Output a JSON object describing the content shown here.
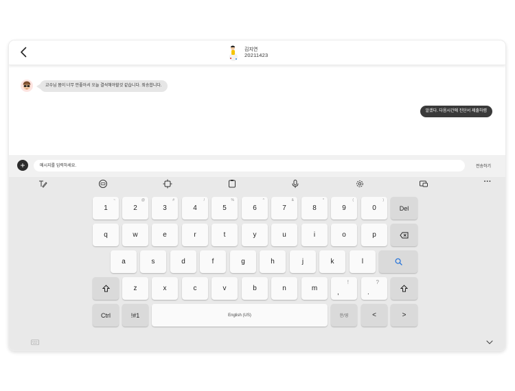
{
  "chat": {
    "back_icon": "chevron-left-icon",
    "contact_name": "김지연",
    "contact_id": "20211423",
    "messages": [
      {
        "direction": "incoming",
        "text": "교수님 몸이 너무 안좋아서 오늘 결석해야할것 같습니다. 죄송합니다."
      },
      {
        "direction": "outgoing",
        "text": "알겠다. 다음시간에 진단서 제출하렴"
      }
    ]
  },
  "composer": {
    "add_icon": "plus-icon",
    "add_label": "+",
    "placeholder": "메시지를 입력하세요.",
    "send_label": "전송하기"
  },
  "keyboard": {
    "toolbar": [
      {
        "name": "handwriting-icon"
      },
      {
        "name": "emoji-icon"
      },
      {
        "name": "resize-icon"
      },
      {
        "name": "clipboard-icon"
      },
      {
        "name": "microphone-icon"
      },
      {
        "name": "settings-icon"
      },
      {
        "name": "one-handed-keyboard-icon"
      },
      {
        "name": "more-icon",
        "label": "···"
      }
    ],
    "number_row": [
      {
        "label": "1",
        "sub": "~"
      },
      {
        "label": "2",
        "sub": "@"
      },
      {
        "label": "3",
        "sub": "#"
      },
      {
        "label": "4",
        "sub": "/"
      },
      {
        "label": "5",
        "sub": "%"
      },
      {
        "label": "6",
        "sub": "^"
      },
      {
        "label": "7",
        "sub": "&"
      },
      {
        "label": "8",
        "sub": "*"
      },
      {
        "label": "9",
        "sub": "("
      },
      {
        "label": "0",
        "sub": ")"
      }
    ],
    "del_label": "Del",
    "row_q": [
      "q",
      "w",
      "e",
      "r",
      "t",
      "y",
      "u",
      "i",
      "o",
      "p"
    ],
    "backspace_icon": "backspace-icon",
    "row_a": [
      "a",
      "s",
      "d",
      "f",
      "g",
      "h",
      "j",
      "k",
      "l"
    ],
    "search_icon": "search-icon",
    "shift_icon": "shift-icon",
    "row_z": [
      "z",
      "x",
      "c",
      "v",
      "b",
      "n",
      "m"
    ],
    "comma_key": {
      "label": ",",
      "sub": "!"
    },
    "period_key": {
      "label": ".",
      "sub": "?"
    },
    "ctrl_label": "Ctrl",
    "symbols_label": "!#1",
    "space_label": "English (US)",
    "lang_switch_label": "한/영",
    "left_arrow_label": "<",
    "right_arrow_label": ">",
    "keyboard_icon": "keyboard-icon",
    "hide_icon": "chevron-down-icon"
  }
}
